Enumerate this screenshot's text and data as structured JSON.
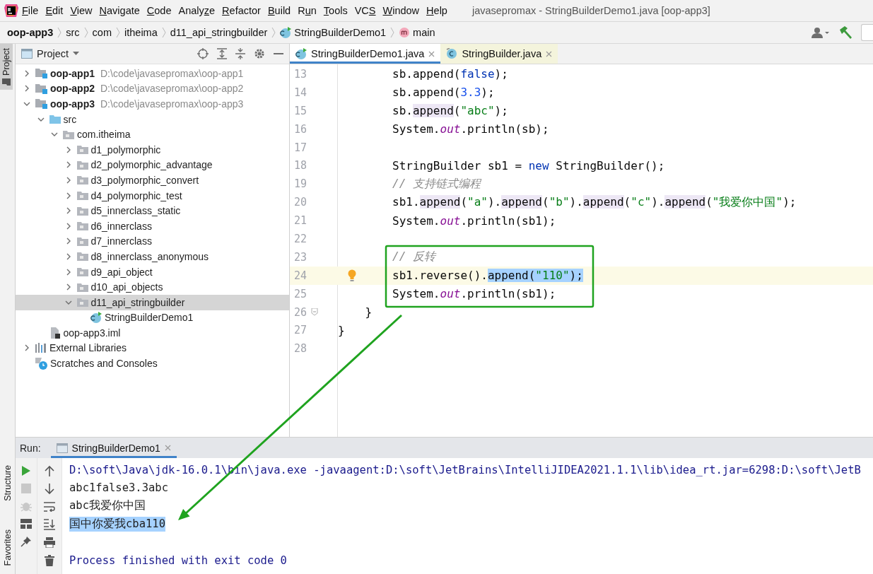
{
  "menu_bar": {
    "items": [
      {
        "key": "F",
        "tail": "ile"
      },
      {
        "key": "E",
        "tail": "dit"
      },
      {
        "key": "V",
        "tail": "iew"
      },
      {
        "key": "N",
        "tail": "avigate"
      },
      {
        "key": "C",
        "tail": "ode"
      },
      {
        "head": "Analy",
        "key": "z",
        "tail": "e"
      },
      {
        "key": "R",
        "tail": "efactor"
      },
      {
        "key": "B",
        "tail": "uild"
      },
      {
        "head": "R",
        "key": "u",
        "tail": "n"
      },
      {
        "key": "T",
        "tail": "ools"
      },
      {
        "head": "VC",
        "key": "S"
      },
      {
        "key": "W",
        "tail": "indow"
      },
      {
        "key": "H",
        "tail": "elp"
      }
    ],
    "title": "javasepromax - StringBuilderDemo1.java [oop-app3]"
  },
  "breadcrumbs": [
    {
      "label": "oop-app3",
      "kind": "module"
    },
    {
      "label": "src",
      "kind": "folder"
    },
    {
      "label": "com",
      "kind": "folder"
    },
    {
      "label": "itheima",
      "kind": "folder"
    },
    {
      "label": "d11_api_stringbuilder",
      "kind": "folder"
    },
    {
      "label": "StringBuilderDemo1",
      "kind": "class"
    },
    {
      "label": "main",
      "kind": "method"
    }
  ],
  "tool_strip": {
    "top": [
      {
        "label": "Project",
        "selected": true
      }
    ],
    "bottom": [
      {
        "label": "Structure",
        "selected": false
      },
      {
        "label": "Favorites",
        "selected": false
      }
    ]
  },
  "project_panel": {
    "title": "Project",
    "tree": [
      {
        "label": "oop-app1",
        "location": "D:\\code\\javasepromax\\oop-app1",
        "kind": "module",
        "expanded": false,
        "selected": false
      },
      {
        "label": "oop-app2",
        "location": "D:\\code\\javasepromax\\oop-app2",
        "kind": "module",
        "expanded": false,
        "selected": false
      },
      {
        "label": "oop-app3",
        "location": "D:\\code\\javasepromax\\oop-app3",
        "kind": "module",
        "expanded": true,
        "selected": false,
        "children": [
          {
            "label": "src",
            "kind": "source-folder",
            "expanded": true,
            "selected": false,
            "children": [
              {
                "label": "com.itheima",
                "kind": "package",
                "expanded": true,
                "selected": false,
                "children": [
                  {
                    "label": "d1_polymorphic",
                    "kind": "package",
                    "expanded": false,
                    "selected": false
                  },
                  {
                    "label": "d2_polymorphic_advantage",
                    "kind": "package",
                    "expanded": false,
                    "selected": false
                  },
                  {
                    "label": "d3_polymorphic_convert",
                    "kind": "package",
                    "expanded": false,
                    "selected": false
                  },
                  {
                    "label": "d4_polymorphic_test",
                    "kind": "package",
                    "expanded": false,
                    "selected": false
                  },
                  {
                    "label": "d5_innerclass_static",
                    "kind": "package",
                    "expanded": false,
                    "selected": false
                  },
                  {
                    "label": "d6_innerclass",
                    "kind": "package",
                    "expanded": false,
                    "selected": false
                  },
                  {
                    "label": "d7_innerclass",
                    "kind": "package",
                    "expanded": false,
                    "selected": false
                  },
                  {
                    "label": "d8_innerclass_anonymous",
                    "kind": "package",
                    "expanded": false,
                    "selected": false
                  },
                  {
                    "label": "d9_api_object",
                    "kind": "package",
                    "expanded": false,
                    "selected": false
                  },
                  {
                    "label": "d10_api_objects",
                    "kind": "package",
                    "expanded": false,
                    "selected": false
                  },
                  {
                    "label": "d11_api_stringbuilder",
                    "kind": "package",
                    "expanded": true,
                    "selected": true,
                    "children": [
                      {
                        "label": "StringBuilderDemo1",
                        "kind": "class",
                        "selected": false
                      }
                    ]
                  }
                ]
              }
            ]
          },
          {
            "label": "oop-app3.iml",
            "kind": "module-file",
            "selected": false
          }
        ]
      },
      {
        "label": "External Libraries",
        "kind": "libraries",
        "expanded": false,
        "selected": false
      },
      {
        "label": "Scratches and Consoles",
        "kind": "scratches",
        "selected": false
      }
    ]
  },
  "editor_tabs": [
    {
      "label": "StringBuilderDemo1.java",
      "kind": "project",
      "selected": true
    },
    {
      "label": "StringBuilder.java",
      "kind": "library",
      "selected": false
    }
  ],
  "code_lines": [
    {
      "number": "13",
      "current": false,
      "tokens": [
        {
          "text": "        sb.append(",
          "kind": "plain"
        },
        {
          "text": "false",
          "kind": "keyword"
        },
        {
          "text": ");",
          "kind": "plain"
        }
      ]
    },
    {
      "number": "14",
      "current": false,
      "tokens": [
        {
          "text": "        sb.append(",
          "kind": "plain"
        },
        {
          "text": "3.3",
          "kind": "number"
        },
        {
          "text": ");",
          "kind": "plain"
        }
      ]
    },
    {
      "number": "15",
      "current": false,
      "tokens": [
        {
          "text": "        sb.",
          "kind": "plain"
        },
        {
          "text": "append",
          "kind": "usage"
        },
        {
          "text": "(",
          "kind": "plain"
        },
        {
          "text": "\"abc\"",
          "kind": "string"
        },
        {
          "text": ");",
          "kind": "plain"
        }
      ]
    },
    {
      "number": "16",
      "current": false,
      "tokens": [
        {
          "text": "        System.",
          "kind": "plain"
        },
        {
          "text": "out",
          "kind": "field"
        },
        {
          "text": ".println(sb);",
          "kind": "plain"
        }
      ]
    },
    {
      "number": "17",
      "current": false
    },
    {
      "number": "18",
      "current": false,
      "tokens": [
        {
          "text": "        StringBuilder sb1 = ",
          "kind": "plain"
        },
        {
          "text": "new",
          "kind": "keyword"
        },
        {
          "text": " StringBuilder();",
          "kind": "plain"
        }
      ]
    },
    {
      "number": "19",
      "current": false,
      "tokens": [
        {
          "text": "        // 支持链式编程",
          "kind": "comment"
        }
      ]
    },
    {
      "number": "20",
      "current": false,
      "tokens": [
        {
          "text": "        sb1.",
          "kind": "plain"
        },
        {
          "text": "append",
          "kind": "usage"
        },
        {
          "text": "(",
          "kind": "plain"
        },
        {
          "text": "\"a\"",
          "kind": "string"
        },
        {
          "text": ").",
          "kind": "plain"
        },
        {
          "text": "append",
          "kind": "usage"
        },
        {
          "text": "(",
          "kind": "plain"
        },
        {
          "text": "\"b\"",
          "kind": "string"
        },
        {
          "text": ").",
          "kind": "plain"
        },
        {
          "text": "append",
          "kind": "usage"
        },
        {
          "text": "(",
          "kind": "plain"
        },
        {
          "text": "\"c\"",
          "kind": "string"
        },
        {
          "text": ").",
          "kind": "plain"
        },
        {
          "text": "append",
          "kind": "usage"
        },
        {
          "text": "(",
          "kind": "plain"
        },
        {
          "text": "\"我爱你中国\"",
          "kind": "string"
        },
        {
          "text": ");",
          "kind": "plain"
        }
      ]
    },
    {
      "number": "21",
      "current": false,
      "tokens": [
        {
          "text": "        System.",
          "kind": "plain"
        },
        {
          "text": "out",
          "kind": "field"
        },
        {
          "text": ".println(sb1);",
          "kind": "plain"
        }
      ]
    },
    {
      "number": "22",
      "current": false
    },
    {
      "number": "23",
      "current": false,
      "tokens": [
        {
          "text": "        // 反转",
          "kind": "comment"
        }
      ]
    },
    {
      "number": "24",
      "current": true,
      "bulb": true,
      "tokens": [
        {
          "text": "        sb1.reverse().",
          "kind": "plain"
        },
        {
          "text": "append(",
          "kind": "selected"
        },
        {
          "text": "\"110\"",
          "kind": "selected-string"
        },
        {
          "text": ");",
          "kind": "selected"
        }
      ]
    },
    {
      "number": "25",
      "current": false,
      "tokens": [
        {
          "text": "        System.",
          "kind": "plain"
        },
        {
          "text": "out",
          "kind": "field"
        },
        {
          "text": ".println(sb1);",
          "kind": "plain"
        }
      ]
    },
    {
      "number": "26",
      "current": false,
      "fold": true,
      "tokens": [
        {
          "text": "    }",
          "kind": "plain"
        }
      ]
    },
    {
      "number": "27",
      "current": false,
      "tokens": [
        {
          "text": "}",
          "kind": "plain"
        }
      ]
    },
    {
      "number": "28",
      "current": false
    }
  ],
  "annotations": [
    {
      "kind": "callout"
    }
  ],
  "run_panel": {
    "label": "Run:",
    "tabs": [
      {
        "label": "StringBuilderDemo1",
        "selected": true
      }
    ],
    "console": [
      {
        "text": "D:\\soft\\Java\\jdk-16.0.1\\bin\\java.exe -javaagent:D:\\soft\\JetBrains\\IntelliJIDEA2021.1.1\\lib\\idea_rt.jar=6298:D:\\soft\\JetB",
        "kind": "command"
      },
      {
        "text": "abc1false3.3abc",
        "kind": "output"
      },
      {
        "text": "abc我爱你中国",
        "kind": "output"
      },
      {
        "text": "国中你爱我cba110",
        "kind": "selected"
      },
      {
        "text": "Process finished with exit code 0",
        "kind": "status"
      }
    ]
  }
}
